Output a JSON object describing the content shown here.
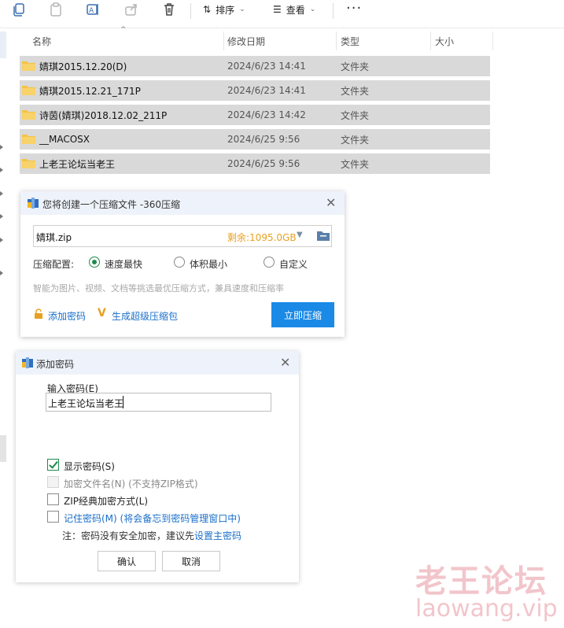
{
  "toolbar": {
    "icons": [
      "copy-icon",
      "paste-icon",
      "rename-icon",
      "share-icon",
      "delete-icon"
    ],
    "sort_label": "排序",
    "view_label": "查看",
    "more_label": "···"
  },
  "columns": {
    "name": "名称",
    "modified": "修改日期",
    "type": "类型",
    "size": "大小"
  },
  "files": [
    {
      "name": "婧琪2015.12.20(D)",
      "date": "2024/6/23 14:41",
      "type": "文件夹"
    },
    {
      "name": "婧琪2015.12.21_171P",
      "date": "2024/6/23 14:41",
      "type": "文件夹"
    },
    {
      "name": "诗茵(婧琪)2018.12.02_211P",
      "date": "2024/6/23 14:42",
      "type": "文件夹"
    },
    {
      "name": "__MACOSX",
      "date": "2024/6/25 9:56",
      "type": "文件夹"
    },
    {
      "name": "上老王论坛当老王",
      "date": "2024/6/25 9:56",
      "type": "文件夹"
    }
  ],
  "compress_dialog": {
    "title": "您将创建一个压缩文件 -360压缩",
    "close": "✕",
    "file_name": "婧琪.zip",
    "space_text": "剩余:1095.0GB",
    "dropdown_arrow": "▼",
    "config_label": "压缩配置:",
    "options": [
      "速度最快",
      "体积最小",
      "自定义"
    ],
    "selected_option": "速度最快",
    "hint": "智能为图片、视频、文档等挑选最优压缩方式，兼具速度和压缩率",
    "add_password": "添加密码",
    "super_package": "生成超级压缩包",
    "compress_now": "立即压缩"
  },
  "password_dialog": {
    "title": "添加密码",
    "close": "✕",
    "input_label": "输入密码(E)",
    "password_value": "上老王论坛当老王",
    "show_password": "显示密码(S)",
    "encrypt_filename": "加密文件名(N) (不支持ZIP格式)",
    "zip_classic": "ZIP经典加密方式(L)",
    "remember_password": "记住密码(M) (将会备忘到密码管理窗口中)",
    "note_prefix": "注：密码没有安全加密，建议先",
    "note_link": "设置主密码",
    "ok": "确认",
    "cancel": "取消"
  },
  "watermark": {
    "line1": "老王论坛",
    "line2": "laowang.vip"
  },
  "colors": {
    "selected_row": "#d9d9d9",
    "accent_blue": "#1a8ae6",
    "link_blue": "#1a6fc9",
    "radio_green": "#1e8a4c",
    "space_orange": "#e8a020",
    "folder_yellow": "#f5c344"
  }
}
